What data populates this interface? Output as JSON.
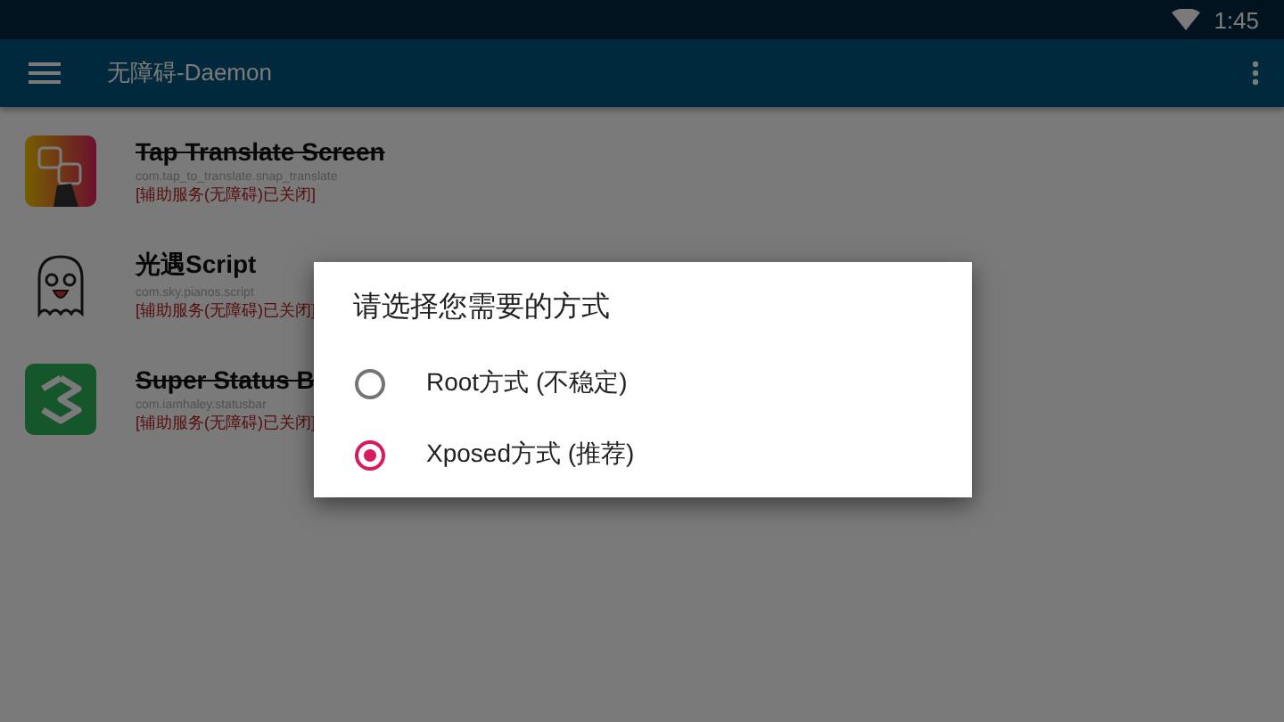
{
  "status_bar": {
    "time": "1:45"
  },
  "toolbar": {
    "title": "无障碍-Daemon"
  },
  "apps": [
    {
      "name": "Tap Translate Screen",
      "package": "com.tap_to_translate.snap_translate",
      "status": "[辅助服务(无障碍)已关闭]",
      "disabled": true,
      "kind": "translate"
    },
    {
      "name": "光遇Script",
      "package": "com.sky.pianos.script",
      "status": "[辅助服务(无障碍)已关闭]",
      "disabled": false,
      "kind": "ghost"
    },
    {
      "name": "Super Status B",
      "package": "com.iamhaley.statusbar",
      "status": "[辅助服务(无障碍)已关闭]",
      "disabled": true,
      "kind": "status"
    }
  ],
  "dialog": {
    "title": "请选择您需要的方式",
    "options": [
      {
        "label": "Root方式 (不稳定)",
        "selected": false
      },
      {
        "label": "Xposed方式 (推荐)",
        "selected": true
      }
    ]
  }
}
